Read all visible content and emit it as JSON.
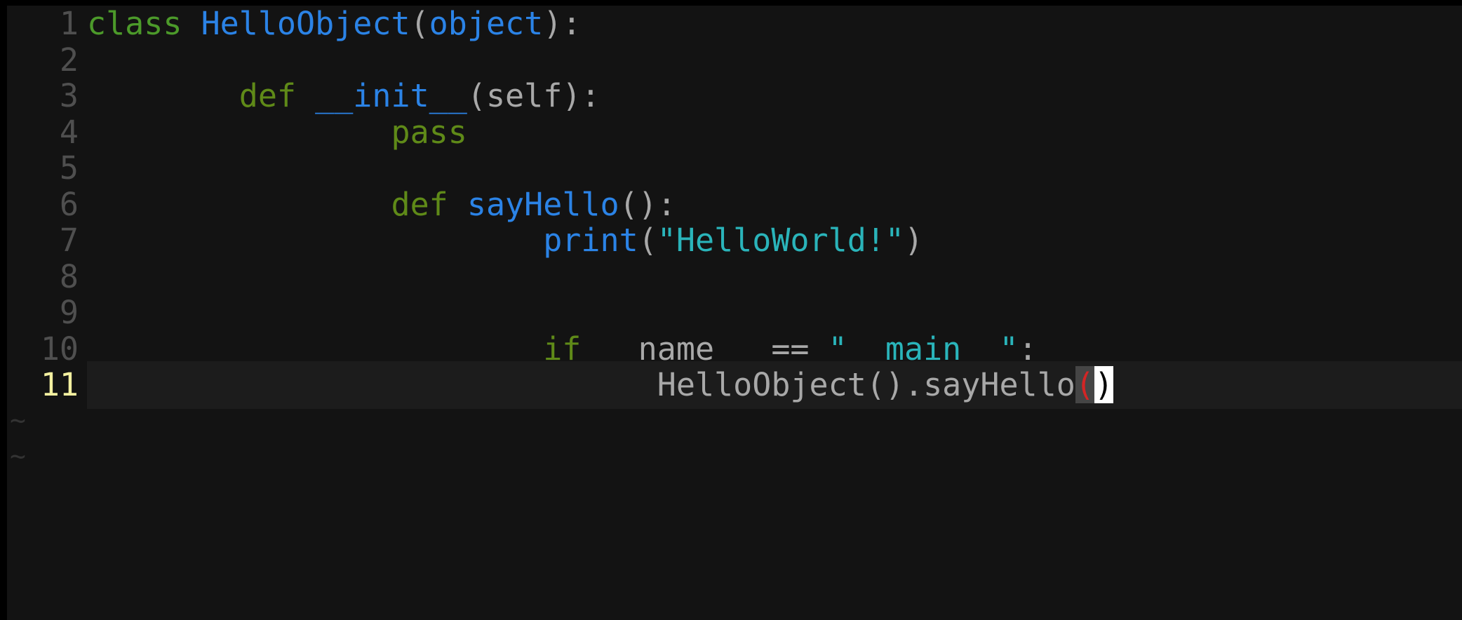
{
  "editor": {
    "lines": [
      {
        "number": "1",
        "indent": "",
        "tokens": [
          {
            "text": "class",
            "kind": "kw-class"
          },
          {
            "text": " ",
            "kind": "plain"
          },
          {
            "text": "HelloObject",
            "kind": "name"
          },
          {
            "text": "(",
            "kind": "plain"
          },
          {
            "text": "object",
            "kind": "builtin"
          },
          {
            "text": "):",
            "kind": "plain"
          }
        ]
      },
      {
        "number": "2",
        "indent": "",
        "tokens": []
      },
      {
        "number": "3",
        "indent": "        ",
        "tokens": [
          {
            "text": "def",
            "kind": "kw-def"
          },
          {
            "text": " ",
            "kind": "plain"
          },
          {
            "text": "__init__",
            "kind": "name"
          },
          {
            "text": "(self):",
            "kind": "plain"
          }
        ]
      },
      {
        "number": "4",
        "indent": "                ",
        "tokens": [
          {
            "text": "pass",
            "kind": "kw-flow"
          }
        ]
      },
      {
        "number": "5",
        "indent": "",
        "tokens": []
      },
      {
        "number": "6",
        "indent": "                ",
        "tokens": [
          {
            "text": "def",
            "kind": "kw-def"
          },
          {
            "text": " ",
            "kind": "plain"
          },
          {
            "text": "sayHello",
            "kind": "name"
          },
          {
            "text": "():",
            "kind": "plain"
          }
        ]
      },
      {
        "number": "7",
        "indent": "                        ",
        "tokens": [
          {
            "text": "print",
            "kind": "builtin"
          },
          {
            "text": "(",
            "kind": "plain"
          },
          {
            "text": "\"HelloWorld!\"",
            "kind": "str"
          },
          {
            "text": ")",
            "kind": "plain"
          }
        ]
      },
      {
        "number": "8",
        "indent": "",
        "tokens": []
      },
      {
        "number": "9",
        "indent": "",
        "tokens": []
      },
      {
        "number": "10",
        "indent": "                        ",
        "tokens": [
          {
            "text": "if",
            "kind": "kw-flow"
          },
          {
            "text": " __name__ == ",
            "kind": "plain"
          },
          {
            "text": "\"__main__\"",
            "kind": "str"
          },
          {
            "text": ":",
            "kind": "plain"
          }
        ]
      },
      {
        "number": "11",
        "indent": "                              ",
        "tokens": [
          {
            "text": "HelloObject().sayHello",
            "kind": "plain"
          },
          {
            "text": "(",
            "kind": "match-open"
          },
          {
            "text": ")",
            "kind": "cursor-close"
          }
        ],
        "current": true
      }
    ],
    "empty_marker": "~",
    "empty_marker_count": 2
  },
  "colors": {
    "background": "#131313",
    "current_line": "#1c1c1c",
    "line_number": "#4f4f4f",
    "current_line_number": "#f3f0a0",
    "keyword": "#5f8a18",
    "identifier": "#2b83e6",
    "string": "#2ab4ba",
    "text": "#a8a8a8",
    "bracket_match": "#d32525",
    "cursor": "#ffffff"
  }
}
